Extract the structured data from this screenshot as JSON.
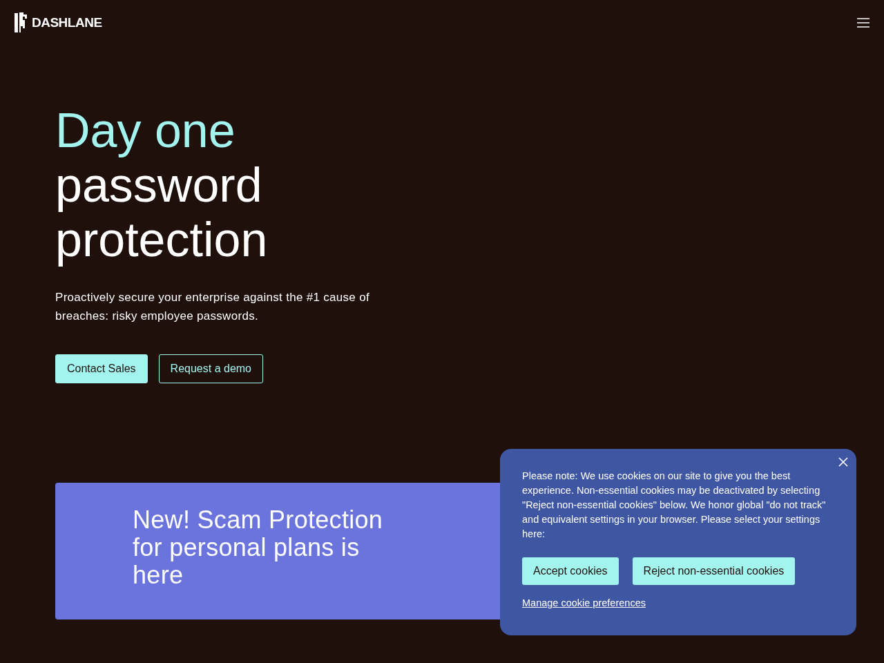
{
  "header": {
    "logo": "DASHLANE"
  },
  "hero": {
    "heading_highlight": "Day one",
    "heading_rest": "password protection",
    "subtitle": "Proactively secure your enterprise against the #1 cause of breaches: risky employee passwords.",
    "buttons": [
      {
        "label": "Contact Sales",
        "kind": "primary"
      },
      {
        "label": "Request a demo",
        "kind": "outline"
      }
    ]
  },
  "banner": {
    "title": "New! Scam Protection for personal plans is here"
  },
  "cookie_dialog": {
    "message": "Please note: We use cookies on our site to give you the best experience. Non-essential cookies may be deactivated by selecting \"Reject non-essential cookies\" below. We honor global \"do not track\" and equivalent settings in your browser. Please select your settings here:",
    "buttons": [
      "Accept cookies",
      "Reject non-essential cookies"
    ],
    "link": "Manage cookie preferences"
  }
}
